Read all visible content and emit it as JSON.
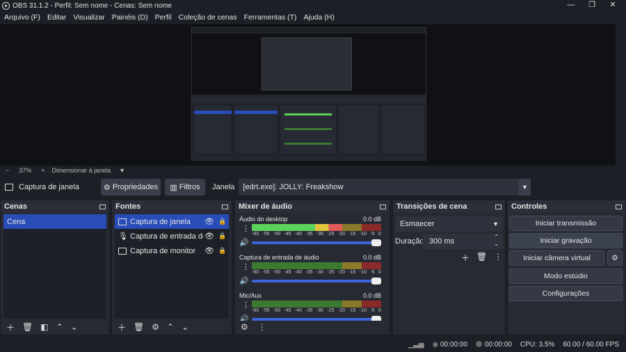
{
  "window": {
    "title": "OBS 31.1.2 - Perfil: Sem nome - Cenas: Sem nome"
  },
  "menu": [
    "Arquivo (F)",
    "Editar",
    "Visualizar",
    "Painéis (D)",
    "Perfil",
    "Coleção de cenas",
    "Ferramentas (T)",
    "Ajuda (H)"
  ],
  "preview_bar": {
    "zoom": "37%",
    "mode": "Dimensionar à janela"
  },
  "source_bar": {
    "source_name": "Captura de janela",
    "properties_label": "Propriedades",
    "filters_label": "Filtros",
    "window_label": "Janela",
    "window_value": "[edrt.exe]: JOLLY: Freakshow"
  },
  "scenes": {
    "title": "Cenas",
    "items": [
      "Cena"
    ]
  },
  "sources": {
    "title": "Fontes",
    "items": [
      "Captura de janela",
      "Captura de entrada de áudio",
      "Captura de monitor"
    ]
  },
  "mixer": {
    "title": "Mixer de áudio",
    "channels": [
      {
        "name": "Áudio do desktop",
        "db": "0.0 dB",
        "level": 0.7
      },
      {
        "name": "Captura de entrada de áudio",
        "db": "0.0 dB",
        "level": 0.0
      },
      {
        "name": "Mic/Aux",
        "db": "0.0 dB",
        "level": 0.0
      }
    ],
    "scale": [
      "-60",
      "-55",
      "-50",
      "-45",
      "-40",
      "-35",
      "-30",
      "-25",
      "-20",
      "-15",
      "-10",
      "-5",
      "0"
    ]
  },
  "transitions": {
    "title": "Transições de cena",
    "selected": "Esmaecer",
    "duration_label": "Duração",
    "duration_value": "300 ms"
  },
  "controls": {
    "title": "Controles",
    "buttons": [
      "Iniciar transmissão",
      "Iniciar gravação",
      "Iniciar câmera virtual",
      "Modo estúdio",
      "Configurações"
    ]
  },
  "status": {
    "stream_time": "00:00:00",
    "rec_time": "00:00:00",
    "cpu": "CPU: 3.5%",
    "fps": "60.00 / 60.00 FPS"
  }
}
